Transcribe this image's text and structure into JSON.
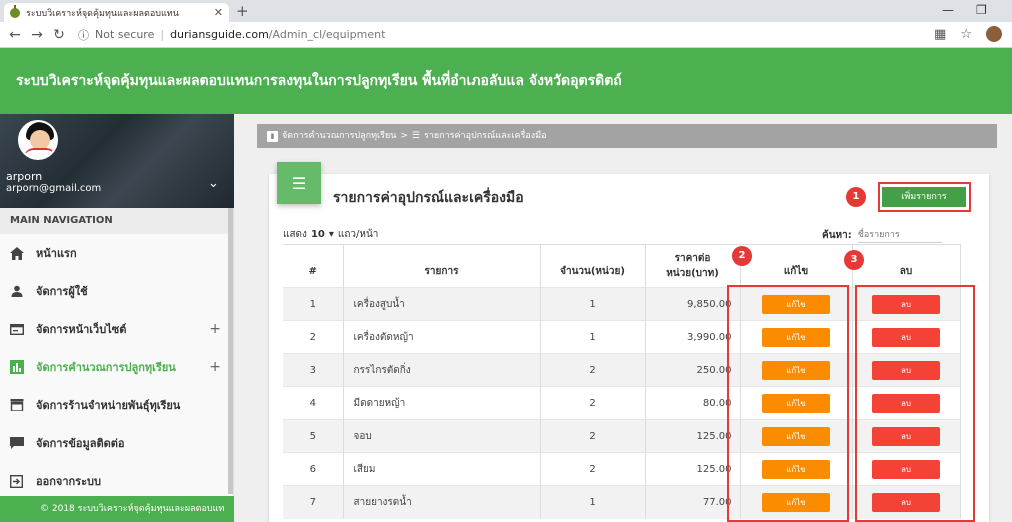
{
  "browser": {
    "tab_title": "ระบบวิเคราะห์จุดคุ้มทุนและผลตอบแทน",
    "new_tab": "+",
    "url_info": "ⓘ",
    "url_secure": "Not secure",
    "url_host": "duriansguide.com",
    "url_path": "/Admin_cl/equipment"
  },
  "header": {
    "title": "ระบบวิเคราะห์จุดคุ้มทุนและผลตอบแทนการลงทุนในการปลูกทุเรียน พื้นที่อำเภอลับแล จังหวัดอุตรดิตถ์"
  },
  "user": {
    "name": "arporn",
    "email": "arporn@gmail.com"
  },
  "sidebar": {
    "nav_header": "MAIN NAVIGATION",
    "items": [
      {
        "label": "หน้าแรก"
      },
      {
        "label": "จัดการผู้ใช้"
      },
      {
        "label": "จัดการหน้าเว็บไซต์",
        "plus": "+"
      },
      {
        "label": "จัดการคำนวณการปลูกทุเรียน",
        "plus": "+"
      },
      {
        "label": "จัดการร้านจำหน่ายพันธุ์ทุเรียน"
      },
      {
        "label": "จัดการข้อมูลติดต่อ"
      },
      {
        "label": "ออกจากระบบ"
      }
    ],
    "footer": "© 2018 ระบบวิเคราะห์จุดคุ้มทุนและผลตอบแท"
  },
  "breadcrumb": {
    "parent": "จัดการคำนวณการปลูกทุเรียน",
    "separator": ">",
    "current": "รายการค่าอุปกรณ์และเครื่องมือ"
  },
  "card": {
    "title": "รายการค่าอุปกรณ์และเครื่องมือ",
    "add_button": "เพิ่มรายการ",
    "show_prefix": "แสดง",
    "show_count": "10",
    "show_suffix": "แถว/หน้า",
    "search_label": "ค้นหา:",
    "search_placeholder": "ชื่อรายการ"
  },
  "markers": {
    "one": "1",
    "two": "2",
    "three": "3"
  },
  "table": {
    "headers": {
      "no": "#",
      "item": "รายการ",
      "qty": "จำนวน(หน่วย)",
      "price_line1": "ราคาต่อ",
      "price_line2": "หน่วย(บาท)",
      "edit": "แก้ไข",
      "delete": "ลบ"
    },
    "edit_label": "แก้ไข",
    "delete_label": "ลบ",
    "rows": [
      {
        "no": "1",
        "item": "เครื่องสูบน้ำ",
        "qty": "1",
        "price": "9,850.00"
      },
      {
        "no": "2",
        "item": "เครื่องตัดหญ้า",
        "qty": "1",
        "price": "3,990.00"
      },
      {
        "no": "3",
        "item": "กรรไกรตัดกิ่ง",
        "qty": "2",
        "price": "250.00"
      },
      {
        "no": "4",
        "item": "มีดดายหญ้า",
        "qty": "2",
        "price": "80.00"
      },
      {
        "no": "5",
        "item": "จอบ",
        "qty": "2",
        "price": "125.00"
      },
      {
        "no": "6",
        "item": "เสียม",
        "qty": "2",
        "price": "125.00"
      },
      {
        "no": "7",
        "item": "สายยางรดน้ำ",
        "qty": "1",
        "price": "77.00"
      }
    ]
  }
}
